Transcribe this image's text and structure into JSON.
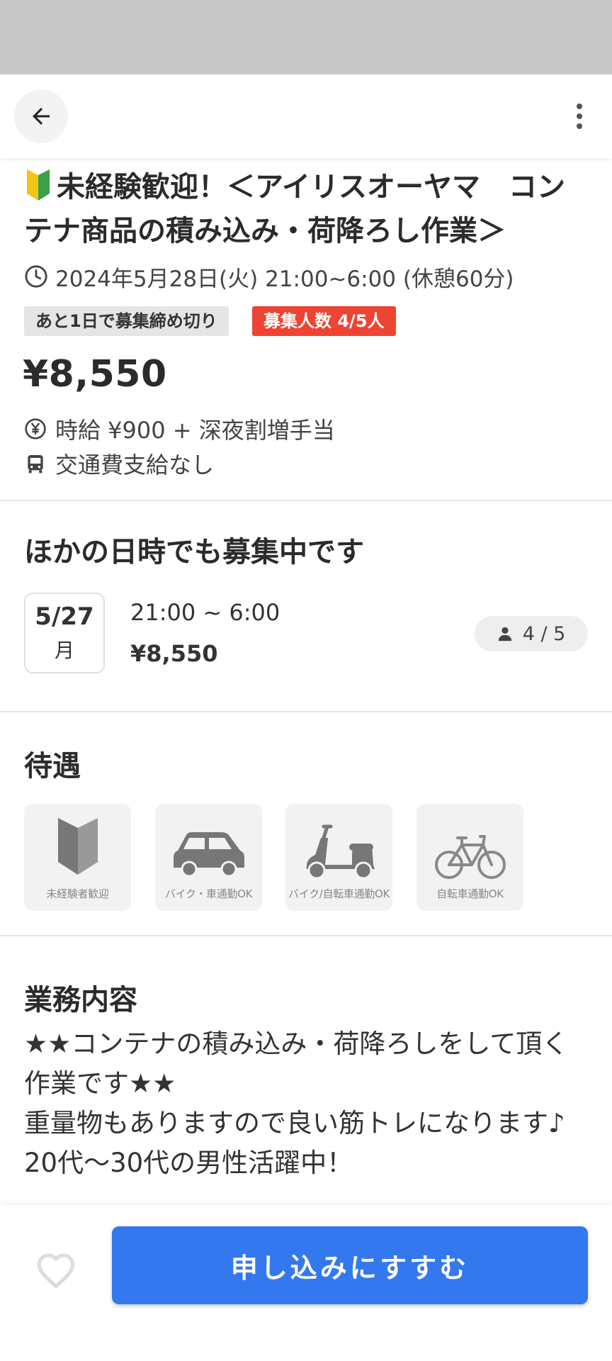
{
  "job": {
    "title": "未経験歓迎！＜アイリスオーヤマ　コンテナ商品の積み込み・荷降ろし作業＞",
    "datetime": "2024年5月28日(火) 21:00~6:00 (休憩60分)",
    "deadline_badge": "あと1日で募集締め切り",
    "recruit_badge": "募集人数 4/5人",
    "price": "¥8,550",
    "wage": "時給 ¥900 + 深夜割増手当",
    "transport": "交通費支給なし"
  },
  "other_dates": {
    "title": "ほかの日時でも募集中です",
    "slot": {
      "date": "5/27",
      "weekday": "月",
      "time": "21:00 ~ 6:00",
      "price": "¥8,550",
      "count": "4 / 5"
    }
  },
  "perks": {
    "title": "待遇",
    "items": [
      {
        "label": "未経験者歓迎",
        "icon": "beginner-icon"
      },
      {
        "label": "バイク・車通勤OK",
        "icon": "car-icon"
      },
      {
        "label": "バイク/自転車通勤OK",
        "icon": "scooter-icon"
      },
      {
        "label": "自転車通勤OK",
        "icon": "bicycle-icon"
      }
    ]
  },
  "work": {
    "title": "業務内容",
    "description": "★★コンテナの積み込み・荷降ろしをして頂く作業です★★\n重量物もありますので良い筋トレになります♪\n20代～30代の男性活躍中！"
  },
  "bottom": {
    "apply_label": "申し込みにすすむ"
  },
  "colors": {
    "accent": "#3478f0",
    "badge_red": "#ee4433",
    "status_bar": "#c8c8c8"
  }
}
